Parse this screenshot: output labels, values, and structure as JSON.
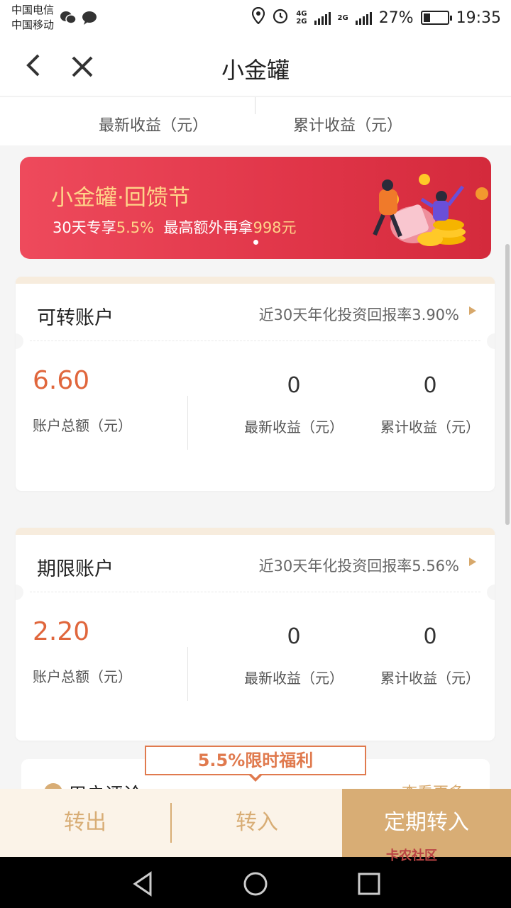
{
  "status_bar": {
    "carrier_1": "中国电信",
    "carrier_2": "中国移动",
    "network_1": "4G",
    "network_2": "2G",
    "network_3": "2G",
    "battery_percent": "27%",
    "battery_level": 0.27,
    "time": "19:35"
  },
  "nav": {
    "title": "小金罐"
  },
  "summary": {
    "latest_label": "最新收益（元）",
    "total_label": "累计收益（元）"
  },
  "banner": {
    "title": "小金罐·回馈节",
    "sub_prefix": "30天专享",
    "sub_rate": "5.5%",
    "sub_mid": "  最高额外再拿",
    "sub_amount": "998元"
  },
  "accounts": [
    {
      "title": "可转账户",
      "rate_text": "近30天年化投资回报率3.90%",
      "amount": "6.60",
      "amount_label": "账户总额（元）",
      "latest_value": "0",
      "latest_label": "最新收益（元）",
      "total_value": "0",
      "total_label": "累计收益（元）"
    },
    {
      "title": "期限账户",
      "rate_text": "近30天年化投资回报率5.56%",
      "amount": "2.20",
      "amount_label": "账户总额（元）",
      "latest_value": "0",
      "latest_label": "最新收益（元）",
      "total_value": "0",
      "total_label": "累计收益（元）"
    }
  ],
  "reviews": {
    "title": "用户评论",
    "more": "查看更多"
  },
  "promo_tag": "5.5%限时福利",
  "bottom": {
    "transfer_out": "转出",
    "transfer_in": "转入",
    "fixed_transfer_in": "定期转入"
  },
  "watermark": "卡农社区",
  "colors": {
    "accent_gold": "#d8ad75",
    "amount_orange": "#e0663c",
    "banner_red": "#e03548"
  }
}
